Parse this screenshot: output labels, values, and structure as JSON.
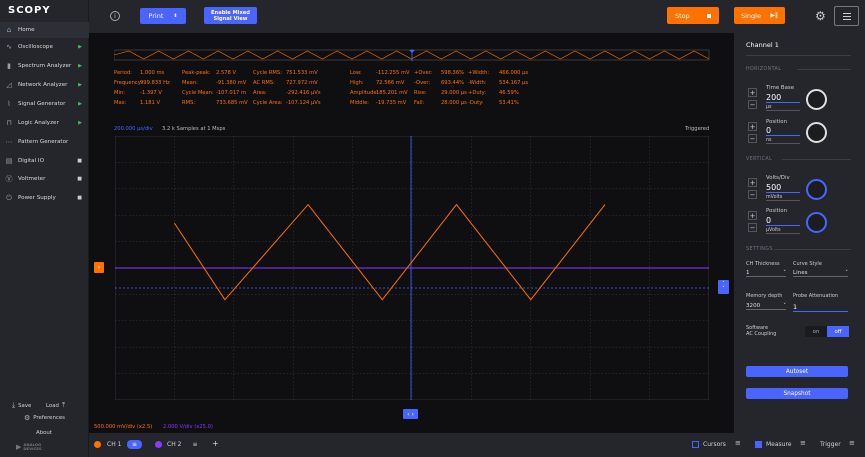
{
  "app": {
    "logo": "SCOPY"
  },
  "sidebar": {
    "items": [
      {
        "label": "Home",
        "icon": "home-icon"
      },
      {
        "label": "Oscilloscope",
        "icon": "oscilloscope-icon",
        "state": "running"
      },
      {
        "label": "Spectrum Analyzer",
        "icon": "spectrum-icon",
        "state": "running"
      },
      {
        "label": "Network Analyzer",
        "icon": "network-icon",
        "state": "running"
      },
      {
        "label": "Signal Generator",
        "icon": "signal-generator-icon",
        "state": "running"
      },
      {
        "label": "Logic Analyzer",
        "icon": "logic-analyzer-icon",
        "state": "running"
      },
      {
        "label": "Pattern Generator",
        "icon": "pattern-generator-icon",
        "state": "none"
      },
      {
        "label": "Digital IO",
        "icon": "digital-io-icon",
        "state": "stopped"
      },
      {
        "label": "Voltmeter",
        "icon": "voltmeter-icon",
        "state": "stopped"
      },
      {
        "label": "Power Supply",
        "icon": "power-supply-icon",
        "state": "stopped"
      }
    ],
    "save": "Save",
    "load": "Load",
    "preferences": "Preferences",
    "about": "About",
    "brand_line1": "ANALOG",
    "brand_line2": "DEVICES"
  },
  "toolbar": {
    "print": "Print",
    "mixed_line1": "Enable Mixed",
    "mixed_line2": "Signal View",
    "stop": "Stop",
    "single": "Single"
  },
  "measurements": [
    [
      {
        "k": "Period:",
        "v": "1.000 ms"
      },
      {
        "k": "Peak-peak:",
        "v": "2.578 V"
      },
      {
        "k": "Cycle RMS:",
        "v": "751.533 mV"
      },
      {
        "k": "Low:",
        "v": "-112.255 mV"
      },
      {
        "k": "+Over:",
        "v": "598.36%"
      },
      {
        "k": "+Width:",
        "v": "466.000 µs"
      }
    ],
    [
      {
        "k": "Frequency:",
        "v": "999.833 Hz"
      },
      {
        "k": "Mean:",
        "v": "-91.380 mV"
      },
      {
        "k": "AC RMS:",
        "v": "727.972 mV"
      },
      {
        "k": "High:",
        "v": "72.566 mV"
      },
      {
        "k": "-Over:",
        "v": "693.44%"
      },
      {
        "k": "-Width:",
        "v": "534.167 µs"
      }
    ],
    [
      {
        "k": "Min:",
        "v": "-1.397 V"
      },
      {
        "k": "Cycle Mean:",
        "v": "-107.017 m"
      },
      {
        "k": "Area:",
        "v": "-292.416 µVs"
      },
      {
        "k": "Amplitude:",
        "v": "185.201 mV"
      },
      {
        "k": "Rise:",
        "v": "29.000 µs"
      },
      {
        "k": "+Duty:",
        "v": "46.59%"
      }
    ],
    [
      {
        "k": "Max:",
        "v": "1.181 V"
      },
      {
        "k": "RMS:",
        "v": "733.685 mV"
      },
      {
        "k": "Cycle Area:",
        "v": "-107.124 µVs"
      },
      {
        "k": "Middle:",
        "v": "-19.735 mV"
      },
      {
        "k": "Fall:",
        "v": "28.000 µs"
      },
      {
        "k": "-Duty:",
        "v": "53.41%"
      }
    ]
  ],
  "plot": {
    "timebase": "200.000 µs/div",
    "samples": "3.2 k Samples at 1 Msps",
    "status": "Triggered",
    "ch1_scale": "500.000 mV/div (x2.5)",
    "ch2_scale": "2.000 V/div (x25.0)"
  },
  "chart_data": {
    "type": "line",
    "x": [
      0,
      0.34,
      0.9,
      1.4,
      1.9,
      2.4,
      2.9
    ],
    "series": [
      {
        "values": [
          0.85,
          -0.6,
          1.2,
          -0.6,
          1.2,
          -0.6,
          1.2
        ]
      }
    ],
    "xlim": [
      -0.4,
      3.6
    ],
    "ylim": [
      -2.5,
      2.5
    ],
    "grid": true,
    "colors": {
      "ch1": "#ff7200",
      "ch2": "#8b38ff",
      "trigger": "#4a64ff"
    }
  },
  "panel": {
    "title": "Channel 1",
    "horizontal": "HORIZONTAL",
    "time_base_label": "Time Base",
    "time_base_value": "200",
    "time_base_unit": "µs",
    "h_position_label": "Position",
    "h_position_value": "0",
    "h_position_unit": "ns",
    "vertical": "VERTICAL",
    "volts_label": "Volts/Div",
    "volts_value": "500",
    "volts_unit": "mVolts",
    "v_position_label": "Position",
    "v_position_value": "0",
    "v_position_unit": "µVolts",
    "settings": "SETTINGS",
    "thickness_label": "CH Thickness",
    "thickness_value": "1",
    "curve_label": "Curve Style",
    "curve_value": "Lines",
    "memory_label": "Memory depth",
    "memory_value": "3200",
    "probe_label": "Probe Attenuation",
    "probe_value": "1",
    "coupling_label1": "Software",
    "coupling_label2": "AC Coupling",
    "on": "on",
    "off": "off",
    "autoset": "Autoset",
    "snapshot": "Snapshot"
  },
  "bottom": {
    "ch1": "CH 1",
    "ch2": "CH 2",
    "add": "+",
    "cursors": "Cursors",
    "measure": "Measure",
    "trigger": "Trigger"
  }
}
